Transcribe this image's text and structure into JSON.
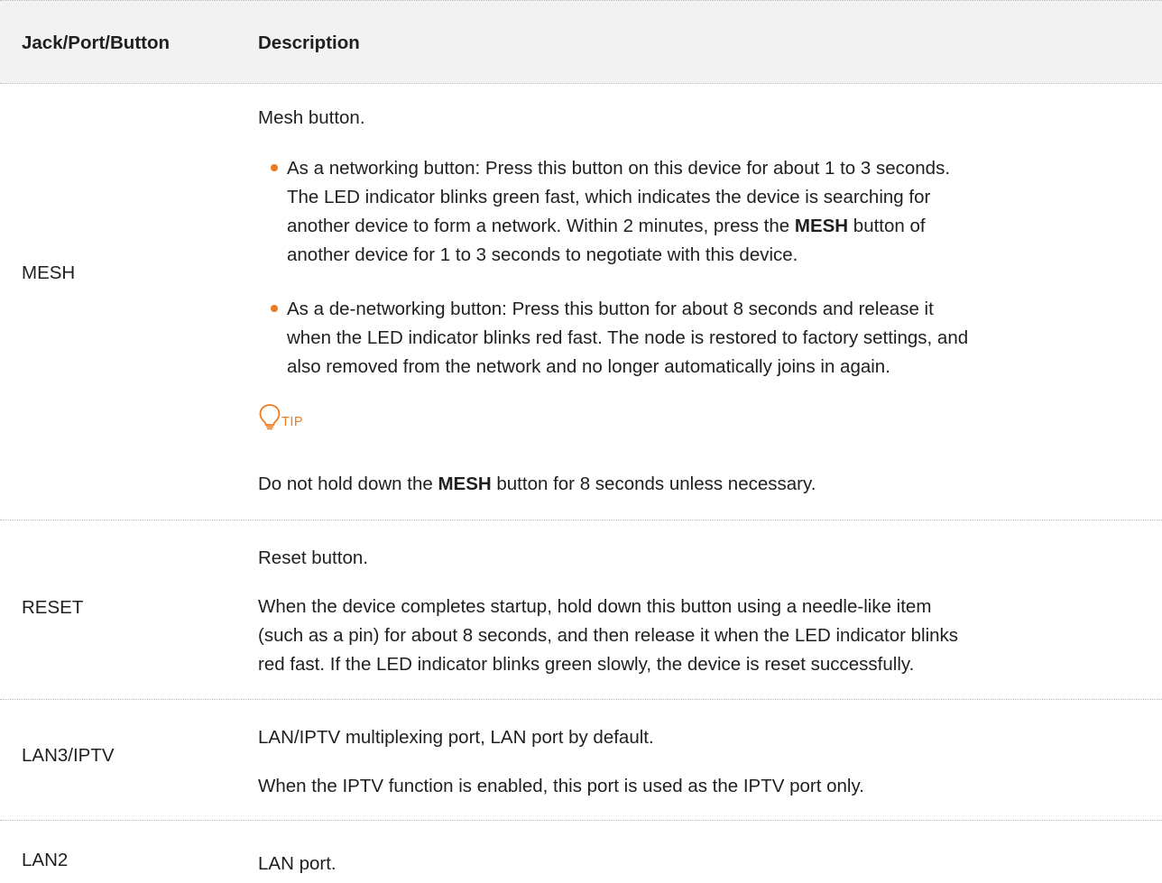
{
  "header": {
    "col1": "Jack/Port/Button",
    "col2": "Description"
  },
  "rows": {
    "mesh": {
      "label": "MESH",
      "intro": "Mesh button.",
      "bullet1": {
        "line1": "As a networking button: Press this button on this device for about 1 to 3 seconds.",
        "line2": "The LED indicator blinks green fast, which indicates the device is searching for",
        "line3_pre": "another device to form a network. Within 2 minutes, press the ",
        "line3_bold": "MESH",
        "line3_post": " button of",
        "line4": "another device for 1 to 3 seconds to negotiate with this device."
      },
      "bullet2": {
        "line1": "As a de-networking button: Press this button for about 8 seconds and release it",
        "line2": "when the LED indicator blinks red fast. The node is restored to factory settings, and",
        "line3": "also removed from the network and no longer automatically joins in again."
      },
      "tip_label": "TIP",
      "tip_text_pre": "Do not hold down the ",
      "tip_text_bold": "MESH",
      "tip_text_post": " button for 8 seconds unless necessary."
    },
    "reset": {
      "label": "RESET",
      "intro": "Reset button.",
      "line1": "When the device completes startup, hold down this button using a needle-like item",
      "line2": "(such as a pin) for about 8 seconds, and then release it when the LED indicator blinks",
      "line3": "red fast. If the LED indicator blinks green slowly, the device is reset successfully."
    },
    "lan3": {
      "label": "LAN3/IPTV",
      "line1": "LAN/IPTV multiplexing port, LAN port by default.",
      "line2": "When the IPTV function is enabled, this port is used as the IPTV port only."
    },
    "lan2": {
      "label": "LAN2",
      "line1": "LAN port."
    }
  },
  "colors": {
    "accent": "#f07a1e",
    "header_bg": "#f2f2f2",
    "divider": "#bdbdbd"
  }
}
